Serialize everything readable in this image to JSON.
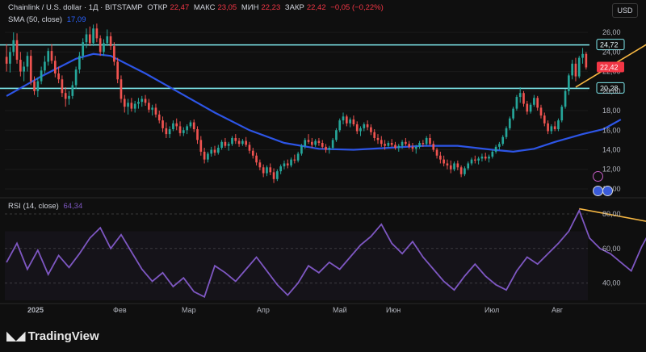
{
  "header": {
    "symbol": "Chainlink / U.S. dollar · 1Д · BITSTAMP",
    "open_label": "ОТКР",
    "open_value": "22,47",
    "high_label": "МАКС",
    "high_value": "23,05",
    "low_label": "МИН",
    "low_value": "22,23",
    "close_label": "ЗАКР",
    "close_value": "22,42",
    "change": "−0,05 (−0,22%)",
    "sma_label": "SMA (50, close)",
    "sma_value": "17,09",
    "rsi_label": "RSI (14, close)",
    "rsi_value": "64,34"
  },
  "currency_button": "USD",
  "brand": "TradingView",
  "colors": {
    "up": "#26a69a",
    "down": "#ef5350",
    "sma": "#2d55e6",
    "rsi": "#7e57c2",
    "level": "#7ee8ec",
    "trend": "#f5b642",
    "price_tag": "#f23645",
    "background": "#0f0f0f"
  },
  "chart_data": {
    "type": "candlestick",
    "price_axis": {
      "range": [
        9.5,
        27
      ],
      "ticks": [
        "26,00",
        "24,00",
        "22,00",
        "20,00",
        "18,00",
        "16,00",
        "14,00",
        "12,00",
        "10,00"
      ]
    },
    "levels": [
      {
        "value": 24.72,
        "label": "24,72"
      },
      {
        "value": 20.28,
        "label": "20,28"
      }
    ],
    "last_price": {
      "value": 22.42,
      "label": "22,42"
    },
    "x_labels": [
      "2025",
      "Фев",
      "Мар",
      "Апр",
      "Май",
      "Июн",
      "Июл",
      "Авг"
    ],
    "rsi_axis": {
      "range": [
        30,
        87
      ],
      "ticks": [
        "80,00",
        "60,00",
        "40,00"
      ]
    },
    "ohlc": [
      [
        23.5,
        24.8,
        22.0,
        22.8
      ],
      [
        22.8,
        24.5,
        21.9,
        24.0
      ],
      [
        24.0,
        26.0,
        23.6,
        25.2
      ],
      [
        25.2,
        25.9,
        22.8,
        23.2
      ],
      [
        23.2,
        24.0,
        21.5,
        22.0
      ],
      [
        22.0,
        23.0,
        21.0,
        22.5
      ],
      [
        22.5,
        24.0,
        22.0,
        23.6
      ],
      [
        23.6,
        24.2,
        20.6,
        21.0
      ],
      [
        21.0,
        21.5,
        19.6,
        20.0
      ],
      [
        20.0,
        21.4,
        19.4,
        21.0
      ],
      [
        21.0,
        22.5,
        20.7,
        22.1
      ],
      [
        22.1,
        23.6,
        21.8,
        23.0
      ],
      [
        23.0,
        24.4,
        22.6,
        24.1
      ],
      [
        24.1,
        24.8,
        22.8,
        23.1
      ],
      [
        23.1,
        23.6,
        21.4,
        21.8
      ],
      [
        21.8,
        22.5,
        20.8,
        21.2
      ],
      [
        21.2,
        21.6,
        19.4,
        19.8
      ],
      [
        19.8,
        20.4,
        18.4,
        19.2
      ],
      [
        19.2,
        20.0,
        18.6,
        19.5
      ],
      [
        19.5,
        21.0,
        19.2,
        20.6
      ],
      [
        20.6,
        22.5,
        20.2,
        22.2
      ],
      [
        22.2,
        24.0,
        21.8,
        23.6
      ],
      [
        23.6,
        25.4,
        23.2,
        25.0
      ],
      [
        25.0,
        26.4,
        24.4,
        25.8
      ],
      [
        25.8,
        26.6,
        24.6,
        24.9
      ],
      [
        24.9,
        26.8,
        24.6,
        26.4
      ],
      [
        26.4,
        26.9,
        25.0,
        25.4
      ],
      [
        25.4,
        25.7,
        23.6,
        24.0
      ],
      [
        24.0,
        25.3,
        23.6,
        24.9
      ],
      [
        24.9,
        26.3,
        24.6,
        25.6
      ],
      [
        25.6,
        26.0,
        24.2,
        24.6
      ],
      [
        24.6,
        25.0,
        22.6,
        23.0
      ],
      [
        23.0,
        23.4,
        20.8,
        21.2
      ],
      [
        21.2,
        21.6,
        18.8,
        19.2
      ],
      [
        19.2,
        19.6,
        17.8,
        18.4
      ],
      [
        18.4,
        19.2,
        17.6,
        18.8
      ],
      [
        18.8,
        19.3,
        17.9,
        18.2
      ],
      [
        18.2,
        19.0,
        17.8,
        18.7
      ],
      [
        18.7,
        19.3,
        18.2,
        18.9
      ],
      [
        18.9,
        19.5,
        18.4,
        19.2
      ],
      [
        19.2,
        19.6,
        18.5,
        18.8
      ],
      [
        18.8,
        19.2,
        17.8,
        18.1
      ],
      [
        18.1,
        18.6,
        17.5,
        18.3
      ],
      [
        18.3,
        18.7,
        17.3,
        17.6
      ],
      [
        17.6,
        18.0,
        16.7,
        17.0
      ],
      [
        17.0,
        17.4,
        15.8,
        16.2
      ],
      [
        16.2,
        16.8,
        15.2,
        15.6
      ],
      [
        15.6,
        16.4,
        15.2,
        16.1
      ],
      [
        16.1,
        17.0,
        15.9,
        16.7
      ],
      [
        16.7,
        17.2,
        16.0,
        16.4
      ],
      [
        16.4,
        16.9,
        15.4,
        15.7
      ],
      [
        15.7,
        16.3,
        15.4,
        16.0
      ],
      [
        16.0,
        16.6,
        15.6,
        16.4
      ],
      [
        16.4,
        17.0,
        16.2,
        16.8
      ],
      [
        16.8,
        17.1,
        15.8,
        16.1
      ],
      [
        16.1,
        16.4,
        14.6,
        15.0
      ],
      [
        15.0,
        15.4,
        13.4,
        13.8
      ],
      [
        13.8,
        14.2,
        12.6,
        13.0
      ],
      [
        13.0,
        13.8,
        12.7,
        13.6
      ],
      [
        13.6,
        14.3,
        13.3,
        14.0
      ],
      [
        14.0,
        14.4,
        13.4,
        13.7
      ],
      [
        13.7,
        14.5,
        13.5,
        14.2
      ],
      [
        14.2,
        15.0,
        14.0,
        14.8
      ],
      [
        14.8,
        15.2,
        14.2,
        14.4
      ],
      [
        14.4,
        14.8,
        13.9,
        14.6
      ],
      [
        14.6,
        15.4,
        14.4,
        15.2
      ],
      [
        15.2,
        15.6,
        14.6,
        14.9
      ],
      [
        14.9,
        15.2,
        14.3,
        14.6
      ],
      [
        14.6,
        15.1,
        14.4,
        14.9
      ],
      [
        14.9,
        15.3,
        14.3,
        14.5
      ],
      [
        14.5,
        14.8,
        13.6,
        13.9
      ],
      [
        13.9,
        14.2,
        13.1,
        13.4
      ],
      [
        13.4,
        13.7,
        12.4,
        12.7
      ],
      [
        12.7,
        13.0,
        11.9,
        12.2
      ],
      [
        12.2,
        12.5,
        11.2,
        11.6
      ],
      [
        11.6,
        12.4,
        11.3,
        12.2
      ],
      [
        12.2,
        12.6,
        11.4,
        11.7
      ],
      [
        11.7,
        12.1,
        10.6,
        11.0
      ],
      [
        11.0,
        12.0,
        10.8,
        11.8
      ],
      [
        11.8,
        12.5,
        11.5,
        12.3
      ],
      [
        12.3,
        12.9,
        12.0,
        12.6
      ],
      [
        12.6,
        13.0,
        12.1,
        12.4
      ],
      [
        12.4,
        13.2,
        12.2,
        13.0
      ],
      [
        13.0,
        13.5,
        12.6,
        12.9
      ],
      [
        12.9,
        13.8,
        12.7,
        13.6
      ],
      [
        13.6,
        14.6,
        13.4,
        14.4
      ],
      [
        14.4,
        15.2,
        14.1,
        15.0
      ],
      [
        15.0,
        15.6,
        14.6,
        14.8
      ],
      [
        14.8,
        15.2,
        14.2,
        14.5
      ],
      [
        14.5,
        15.1,
        14.3,
        14.9
      ],
      [
        14.9,
        15.2,
        14.4,
        14.7
      ],
      [
        14.7,
        15.0,
        14.1,
        14.3
      ],
      [
        14.3,
        14.6,
        13.7,
        14.0
      ],
      [
        14.0,
        14.4,
        13.6,
        14.2
      ],
      [
        14.2,
        15.2,
        14.0,
        15.0
      ],
      [
        15.0,
        16.2,
        14.8,
        16.0
      ],
      [
        16.0,
        17.2,
        15.8,
        17.0
      ],
      [
        17.0,
        17.8,
        16.6,
        17.4
      ],
      [
        17.4,
        17.6,
        16.4,
        16.7
      ],
      [
        16.7,
        17.3,
        16.3,
        17.1
      ],
      [
        17.1,
        17.5,
        16.4,
        16.6
      ],
      [
        16.6,
        16.9,
        15.6,
        15.9
      ],
      [
        15.9,
        16.4,
        15.4,
        16.2
      ],
      [
        16.2,
        16.8,
        15.9,
        16.6
      ],
      [
        16.6,
        17.0,
        16.0,
        16.3
      ],
      [
        16.3,
        16.6,
        15.5,
        15.8
      ],
      [
        15.8,
        16.1,
        14.9,
        15.2
      ],
      [
        15.2,
        15.6,
        14.6,
        15.0
      ],
      [
        15.0,
        15.4,
        14.3,
        14.6
      ],
      [
        14.6,
        15.0,
        14.0,
        14.4
      ],
      [
        14.4,
        14.9,
        14.2,
        14.7
      ],
      [
        14.7,
        15.1,
        14.3,
        14.5
      ],
      [
        14.5,
        14.8,
        14.0,
        14.2
      ],
      [
        14.2,
        14.6,
        13.8,
        14.4
      ],
      [
        14.4,
        15.0,
        14.1,
        14.8
      ],
      [
        14.8,
        15.2,
        14.4,
        14.6
      ],
      [
        14.6,
        14.9,
        14.1,
        14.3
      ],
      [
        14.3,
        14.7,
        13.8,
        14.1
      ],
      [
        14.1,
        14.5,
        13.6,
        14.3
      ],
      [
        14.3,
        14.9,
        14.1,
        14.7
      ],
      [
        14.7,
        15.0,
        14.3,
        14.6
      ],
      [
        14.6,
        15.4,
        14.4,
        15.2
      ],
      [
        15.2,
        15.6,
        14.4,
        14.6
      ],
      [
        14.6,
        14.9,
        13.8,
        14.0
      ],
      [
        14.0,
        14.2,
        13.1,
        13.4
      ],
      [
        13.4,
        13.8,
        12.6,
        13.0
      ],
      [
        13.0,
        13.4,
        12.3,
        12.6
      ],
      [
        12.6,
        13.0,
        12.0,
        12.4
      ],
      [
        12.4,
        12.9,
        11.6,
        12.0
      ],
      [
        12.0,
        12.8,
        11.8,
        12.6
      ],
      [
        12.6,
        12.9,
        11.9,
        12.2
      ],
      [
        12.2,
        12.4,
        11.2,
        11.5
      ],
      [
        11.5,
        12.3,
        11.3,
        12.1
      ],
      [
        12.1,
        12.8,
        11.9,
        12.6
      ],
      [
        12.6,
        13.2,
        12.4,
        13.0
      ],
      [
        13.0,
        13.4,
        12.6,
        12.9
      ],
      [
        12.9,
        13.3,
        12.5,
        13.1
      ],
      [
        13.1,
        13.6,
        12.8,
        13.3
      ],
      [
        13.3,
        13.7,
        12.9,
        13.1
      ],
      [
        13.1,
        13.5,
        12.7,
        13.3
      ],
      [
        13.3,
        14.0,
        13.1,
        13.8
      ],
      [
        13.8,
        14.5,
        13.6,
        14.3
      ],
      [
        14.3,
        14.8,
        14.0,
        14.6
      ],
      [
        14.6,
        15.5,
        14.4,
        15.3
      ],
      [
        15.3,
        16.4,
        15.1,
        16.2
      ],
      [
        16.2,
        17.4,
        16.0,
        17.2
      ],
      [
        17.2,
        18.4,
        17.0,
        18.2
      ],
      [
        18.2,
        19.6,
        18.0,
        19.4
      ],
      [
        19.4,
        20.4,
        18.8,
        19.8
      ],
      [
        19.8,
        20.0,
        18.4,
        18.7
      ],
      [
        18.7,
        19.0,
        17.6,
        17.9
      ],
      [
        17.9,
        18.8,
        17.7,
        18.6
      ],
      [
        18.6,
        19.6,
        18.4,
        19.3
      ],
      [
        19.3,
        19.5,
        18.0,
        18.3
      ],
      [
        18.3,
        18.6,
        17.2,
        17.5
      ],
      [
        17.5,
        17.8,
        16.4,
        16.7
      ],
      [
        16.7,
        17.0,
        15.6,
        15.9
      ],
      [
        15.9,
        16.6,
        15.6,
        16.4
      ],
      [
        16.4,
        16.9,
        15.9,
        16.1
      ],
      [
        16.1,
        17.2,
        15.9,
        17.0
      ],
      [
        17.0,
        18.6,
        16.8,
        18.4
      ],
      [
        18.4,
        20.2,
        18.2,
        20.0
      ],
      [
        20.0,
        21.8,
        19.6,
        21.6
      ],
      [
        21.6,
        23.2,
        21.2,
        22.8
      ],
      [
        22.8,
        23.4,
        21.0,
        21.5
      ],
      [
        21.5,
        23.6,
        21.3,
        23.4
      ],
      [
        23.4,
        24.4,
        22.8,
        23.8
      ],
      [
        23.8,
        24.0,
        22.2,
        22.42
      ]
    ],
    "sma": [
      [
        0,
        19.5
      ],
      [
        10,
        21.5
      ],
      [
        20,
        23.3
      ],
      [
        25,
        23.8
      ],
      [
        30,
        23.6
      ],
      [
        40,
        21.8
      ],
      [
        50,
        19.8
      ],
      [
        60,
        17.8
      ],
      [
        70,
        16.0
      ],
      [
        80,
        14.7
      ],
      [
        90,
        14.1
      ],
      [
        100,
        14.0
      ],
      [
        110,
        14.2
      ],
      [
        120,
        14.4
      ],
      [
        130,
        14.4
      ],
      [
        140,
        14.0
      ],
      [
        146,
        13.8
      ],
      [
        152,
        14.1
      ],
      [
        158,
        14.8
      ],
      [
        166,
        15.6
      ],
      [
        172,
        16.1
      ],
      [
        177,
        17.09
      ]
    ],
    "rsi": [
      [
        0,
        52
      ],
      [
        3,
        63
      ],
      [
        6,
        48
      ],
      [
        9,
        59
      ],
      [
        12,
        45
      ],
      [
        15,
        56
      ],
      [
        18,
        49
      ],
      [
        21,
        57
      ],
      [
        24,
        66
      ],
      [
        27,
        72
      ],
      [
        30,
        60
      ],
      [
        33,
        68
      ],
      [
        36,
        58
      ],
      [
        39,
        48
      ],
      [
        42,
        41
      ],
      [
        45,
        46
      ],
      [
        48,
        38
      ],
      [
        51,
        43
      ],
      [
        54,
        35
      ],
      [
        57,
        32
      ],
      [
        60,
        50
      ],
      [
        63,
        46
      ],
      [
        66,
        41
      ],
      [
        69,
        48
      ],
      [
        72,
        55
      ],
      [
        75,
        47
      ],
      [
        78,
        39
      ],
      [
        81,
        33
      ],
      [
        84,
        40
      ],
      [
        87,
        50
      ],
      [
        90,
        46
      ],
      [
        93,
        52
      ],
      [
        96,
        48
      ],
      [
        99,
        55
      ],
      [
        102,
        62
      ],
      [
        105,
        67
      ],
      [
        108,
        74
      ],
      [
        111,
        63
      ],
      [
        114,
        57
      ],
      [
        117,
        64
      ],
      [
        120,
        55
      ],
      [
        123,
        48
      ],
      [
        126,
        41
      ],
      [
        129,
        36
      ],
      [
        132,
        44
      ],
      [
        135,
        51
      ],
      [
        138,
        44
      ],
      [
        141,
        39
      ],
      [
        144,
        36
      ],
      [
        147,
        47
      ],
      [
        150,
        55
      ],
      [
        153,
        51
      ],
      [
        156,
        57
      ],
      [
        159,
        63
      ],
      [
        162,
        70
      ],
      [
        165,
        82
      ],
      [
        168,
        66
      ],
      [
        171,
        60
      ],
      [
        174,
        57
      ],
      [
        177,
        52
      ],
      [
        180,
        47
      ],
      [
        183,
        61
      ],
      [
        186,
        72
      ],
      [
        189,
        75
      ],
      [
        192,
        64.34
      ]
    ]
  }
}
